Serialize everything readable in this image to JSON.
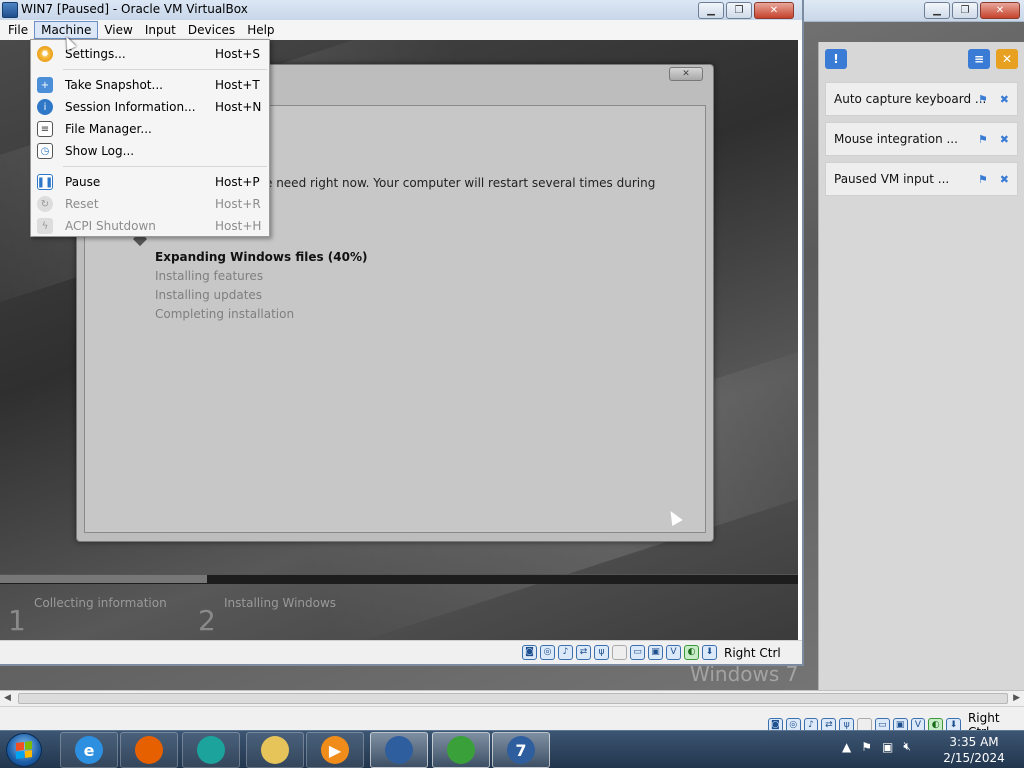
{
  "vm_window": {
    "title": "WIN7 [Paused] - Oracle VM VirtualBox",
    "menus": [
      "File",
      "Machine",
      "View",
      "Input",
      "Devices",
      "Help"
    ],
    "active_menu": "Machine"
  },
  "machine_menu": {
    "items": [
      {
        "label": "Settings...",
        "shortcut": "Host+S",
        "icon": "settings-gear-icon",
        "enabled": true
      },
      {
        "label": "Take Snapshot...",
        "shortcut": "Host+T",
        "icon": "take-snapshot-icon",
        "enabled": true
      },
      {
        "label": "Session Information...",
        "shortcut": "Host+N",
        "icon": "session-info-icon",
        "enabled": true
      },
      {
        "label": "File Manager...",
        "shortcut": "",
        "icon": "file-manager-icon",
        "enabled": true
      },
      {
        "label": "Show Log...",
        "shortcut": "",
        "icon": "show-log-icon",
        "enabled": true
      },
      {
        "label": "Pause",
        "shortcut": "Host+P",
        "icon": "pause-icon",
        "enabled": true
      },
      {
        "label": "Reset",
        "shortcut": "Host+R",
        "icon": "reset-icon",
        "enabled": false
      },
      {
        "label": "ACPI Shutdown",
        "shortcut": "Host+H",
        "icon": "acpi-shutdown-icon",
        "enabled": false
      }
    ]
  },
  "guest_setup": {
    "description_visible": "e need right now. Your computer will restart several times during",
    "steps": [
      {
        "label": "Expanding Windows files (40%)",
        "state": "current"
      },
      {
        "label": "Installing features",
        "state": "pending"
      },
      {
        "label": "Installing updates",
        "state": "pending"
      },
      {
        "label": "Completing installation",
        "state": "pending"
      }
    ],
    "progress_fraction": 0.26,
    "phases": [
      {
        "number": "1",
        "label": "Collecting information"
      },
      {
        "number": "2",
        "label": "Installing Windows"
      }
    ]
  },
  "vm_statusbar": {
    "host_key_label": "Right Ctrl",
    "icons": [
      "hard-disk-icon",
      "optical-drive-icon",
      "audio-icon",
      "network-icon",
      "usb-icon",
      "shared-folders-icon",
      "display-icon",
      "video-capture-icon",
      "mouse-integration-icon",
      "keyboard-capture-icon"
    ]
  },
  "notification_center": {
    "items": [
      {
        "text": "Auto capture keyboard ..."
      },
      {
        "text": "Mouse integration ..."
      },
      {
        "text": "Paused VM input ..."
      }
    ]
  },
  "outer_statusbar": {
    "host_key_label": "Right Ctrl"
  },
  "outer_background_text": "Windows 7",
  "taskbar": {
    "items": [
      {
        "name": "internet-explorer",
        "icon": "internet-explorer-icon",
        "glyph": "e",
        "color": "#2d8fe0"
      },
      {
        "name": "firefox",
        "icon": "firefox-icon",
        "glyph": "",
        "color": "#e66000"
      },
      {
        "name": "media-center",
        "icon": "media-icon",
        "glyph": "",
        "color": "#1ba39c"
      },
      {
        "name": "explorer",
        "icon": "folder-icon",
        "glyph": "",
        "color": "#e7c45a"
      },
      {
        "name": "media-player",
        "icon": "media-player-icon",
        "glyph": "▶",
        "color": "#f08c1a"
      },
      {
        "name": "virtualbox",
        "icon": "virtualbox-icon",
        "glyph": "",
        "color": "#2f5e9e"
      },
      {
        "name": "download-manager",
        "icon": "download-manager-icon",
        "glyph": "",
        "color": "#3aa03a"
      },
      {
        "name": "win7-vm",
        "icon": "win7-vm-icon",
        "glyph": "7",
        "color": "#2f5e9e"
      }
    ],
    "clock": {
      "time": "3:35 AM",
      "date": "2/15/2024"
    }
  }
}
